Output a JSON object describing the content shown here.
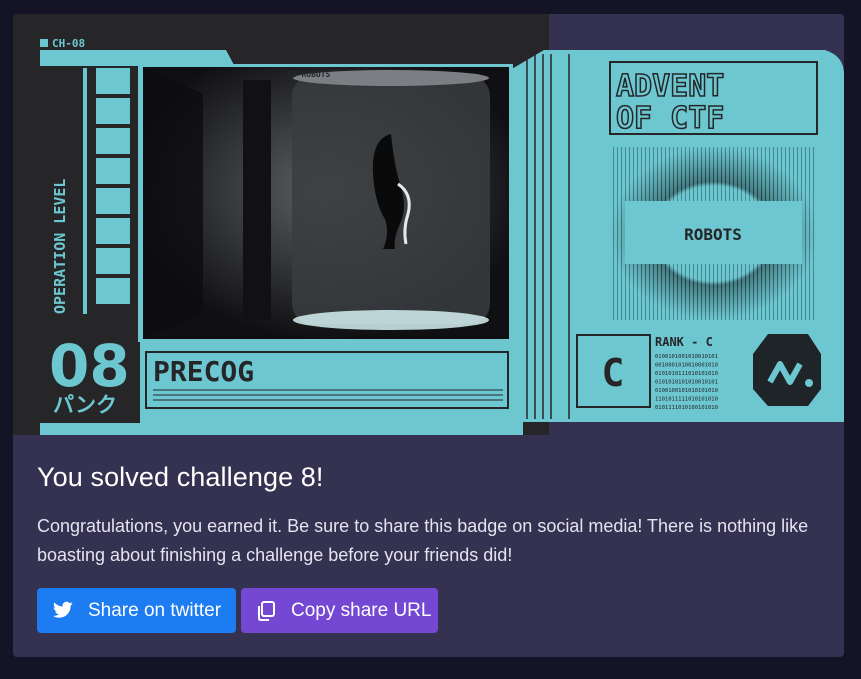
{
  "badge": {
    "channel": "CH-08",
    "tab_label": "08 ROBOTS",
    "side_label": "OPERATION LEVEL",
    "number": "08",
    "katakana": "パンク",
    "name": "PRECOG",
    "brand_line1": "ADVENT",
    "brand_line2": "OF CTF",
    "category": "ROBOTS",
    "rank": "RANK - C",
    "rank_letter": "C",
    "binary": [
      "0100101001010010101",
      "0010001010010001010",
      "0101010111010101010",
      "0101010101010010101",
      "0100100101010101010",
      "1101011111010101010",
      "0101111010100101010"
    ],
    "colors": {
      "teal": "#6cc7d1",
      "dark": "#1c1c1f",
      "navy": "#2c2d45"
    }
  },
  "content": {
    "title": "You solved challenge 8!",
    "message": "Congratulations, you earned it. Be sure to share this badge on social media! There is nothing like boasting about finishing a challenge before your friends did!"
  },
  "buttons": {
    "twitter": {
      "label": "Share on twitter",
      "icon": "twitter-icon",
      "color": "#1d7cf2"
    },
    "copy": {
      "label": "Copy share URL",
      "icon": "copy-icon",
      "color": "#7548d4"
    }
  }
}
